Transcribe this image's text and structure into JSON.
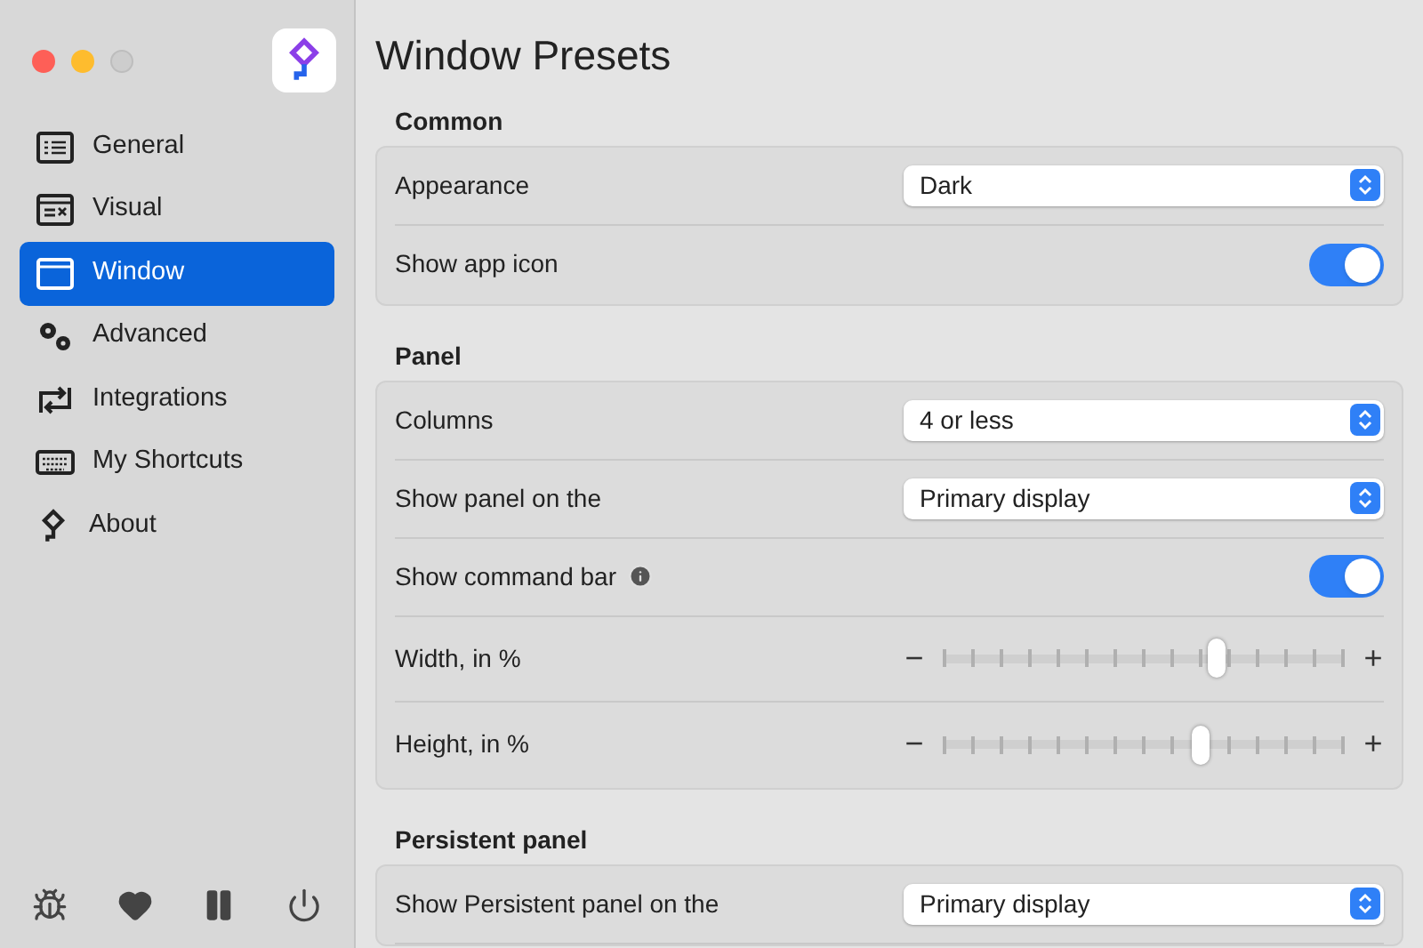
{
  "window": {
    "title": "Window Presets"
  },
  "sidebar": {
    "items": [
      {
        "label": "General",
        "selected": false
      },
      {
        "label": "Visual",
        "selected": false
      },
      {
        "label": "Window",
        "selected": true
      },
      {
        "label": "Advanced",
        "selected": false
      },
      {
        "label": "Integrations",
        "selected": false
      },
      {
        "label": "My Shortcuts",
        "selected": false
      },
      {
        "label": "About",
        "selected": false
      }
    ]
  },
  "sections": [
    {
      "title": "Common",
      "rows": [
        {
          "kind": "select",
          "label": "Appearance",
          "value": "Dark"
        },
        {
          "kind": "toggle",
          "label": "Show app icon",
          "on": true
        }
      ]
    },
    {
      "title": "Panel",
      "rows": [
        {
          "kind": "select",
          "label": "Columns",
          "value": "4 or less"
        },
        {
          "kind": "select",
          "label": "Show panel on the",
          "value": "Primary display"
        },
        {
          "kind": "toggle",
          "label": "Show command bar",
          "on": true,
          "info": true
        },
        {
          "kind": "slider",
          "label": "Width, in %",
          "level": 0.68,
          "minus": "−",
          "plus": "+"
        },
        {
          "kind": "slider",
          "label": "Height, in %",
          "level": 0.64,
          "minus": "−",
          "plus": "+"
        }
      ]
    },
    {
      "title": "Persistent panel",
      "rows": [
        {
          "kind": "select",
          "label": "Show Persistent panel on the",
          "value": "Primary display"
        }
      ]
    }
  ]
}
